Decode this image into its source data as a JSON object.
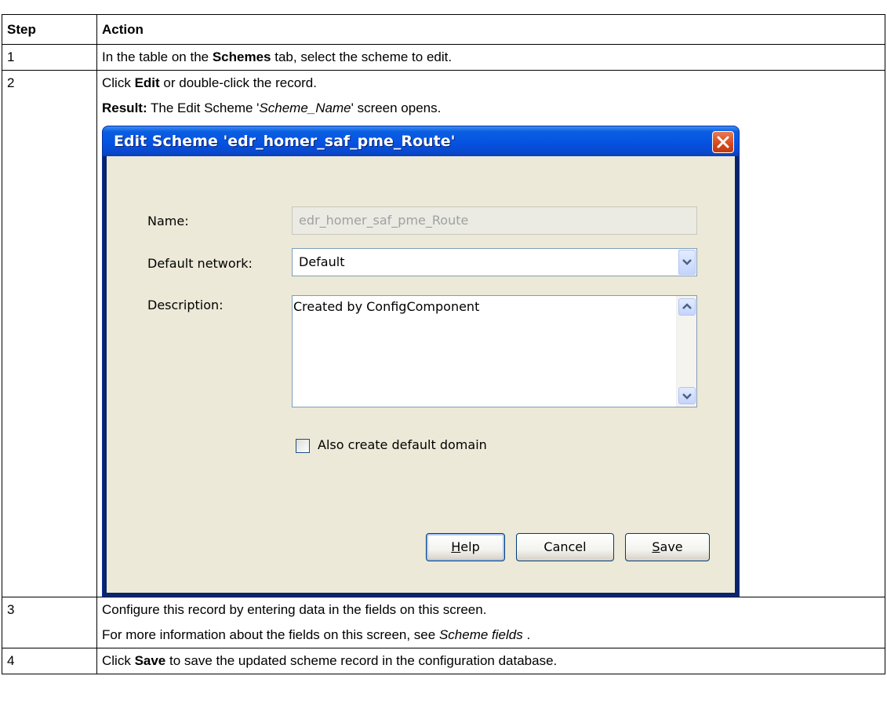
{
  "table": {
    "headers": {
      "step": "Step",
      "action": "Action"
    },
    "rows": [
      {
        "step": "1",
        "pre": "In the table on the ",
        "bold": "Schemes",
        "post": " tab, select the scheme to edit."
      },
      {
        "step": "2",
        "line1_pre": "Click ",
        "line1_bold": "Edit",
        "line1_post": " or double-click the record.",
        "result_label": "Result:",
        "result_pre": " The Edit Scheme '",
        "result_italic": "Scheme_Name",
        "result_post": "' screen opens."
      },
      {
        "step": "3",
        "line1": "Configure this record by entering data in the fields on this screen.",
        "line2_pre": "For more information about the fields on this screen, see ",
        "line2_italic": "Scheme fields",
        "line2_post": " ."
      },
      {
        "step": "4",
        "pre": "Click ",
        "bold": "Save",
        "post": " to save the updated scheme record in the configuration database."
      }
    ]
  },
  "dialog": {
    "title": "Edit Scheme 'edr_homer_saf_pme_Route'",
    "name_label": "Name:",
    "name_value": "edr_homer_saf_pme_Route",
    "network_label": "Default network:",
    "network_value": "Default",
    "description_label": "Description:",
    "description_value": "Created by ConfigComponent",
    "checkbox_label": "Also create default domain",
    "checkbox_checked": false,
    "help_label_mn": "H",
    "help_label_rest": "elp",
    "cancel_label": "Cancel",
    "save_label_mn": "S",
    "save_label_rest": "ave",
    "icons": [
      "close-icon",
      "chevron-down-icon",
      "arrow-up-icon",
      "arrow-down-icon"
    ]
  }
}
